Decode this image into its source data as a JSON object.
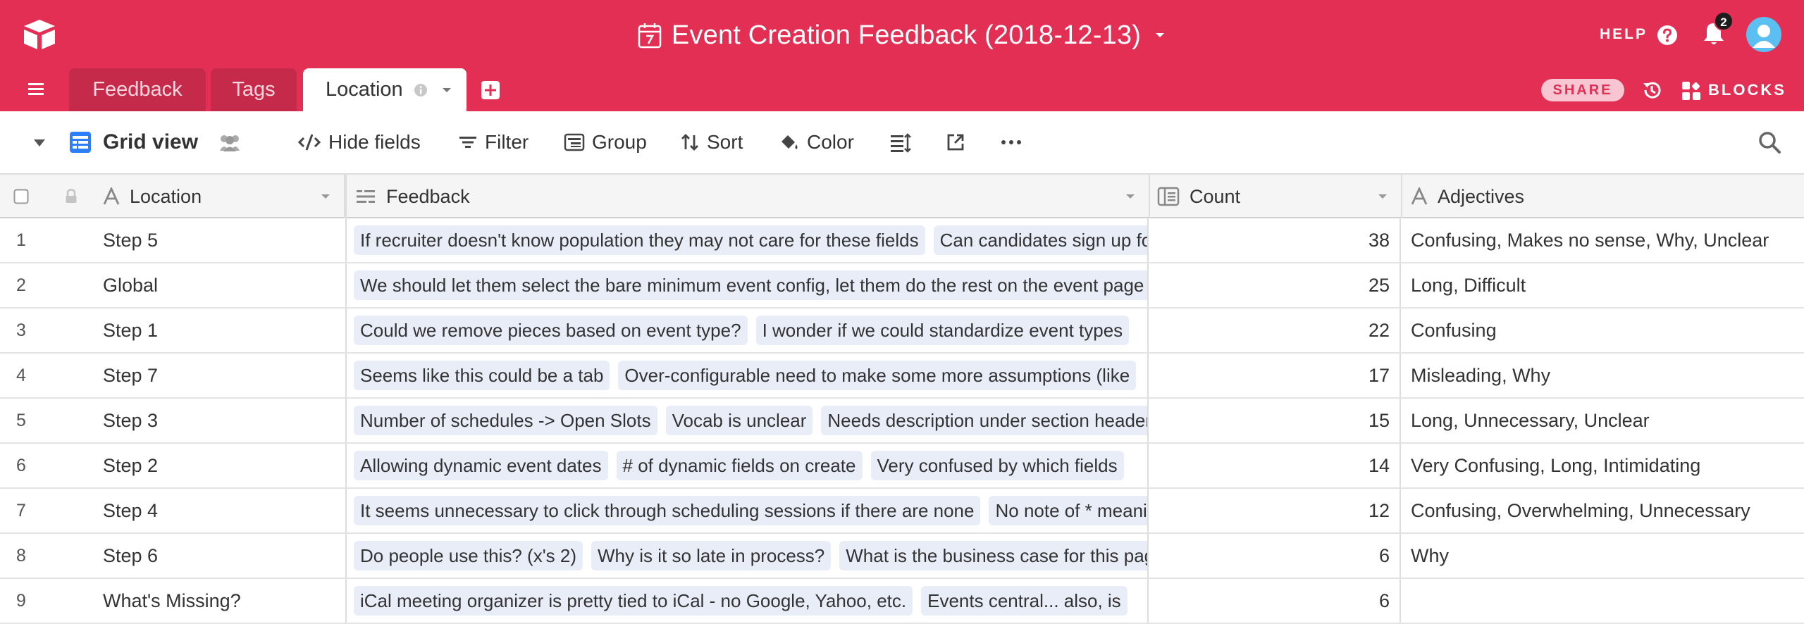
{
  "app": {
    "base_title": "Event Creation Feedback (2018-12-13)",
    "help_label": "HELP",
    "notification_count": "2",
    "share_label": "SHARE",
    "blocks_label": "BLOCKS"
  },
  "tabs": [
    {
      "label": "Feedback",
      "active": false
    },
    {
      "label": "Tags",
      "active": false
    },
    {
      "label": "Location",
      "active": true
    }
  ],
  "viewbar": {
    "view_name": "Grid view",
    "hide_fields": "Hide fields",
    "filter": "Filter",
    "group": "Group",
    "sort": "Sort",
    "color": "Color"
  },
  "columns": {
    "location": "Location",
    "feedback": "Feedback",
    "count": "Count",
    "adjectives": "Adjectives"
  },
  "rows": [
    {
      "num": "1",
      "location": "Step 5",
      "feedback": [
        "If recruiter doesn't know population they may not care for these fields",
        "Can candidates sign up for this"
      ],
      "count": "38",
      "adjectives": "Confusing, Makes no sense, Why, Unclear"
    },
    {
      "num": "2",
      "location": "Global",
      "feedback": [
        "We should let them select the bare minimum event config, let them do the rest on the event page"
      ],
      "count": "25",
      "adjectives": "Long, Difficult"
    },
    {
      "num": "3",
      "location": "Step 1",
      "feedback": [
        "Could we remove pieces based on event type?",
        "I wonder if we could standardize event types"
      ],
      "count": "22",
      "adjectives": "Confusing"
    },
    {
      "num": "4",
      "location": "Step 7",
      "feedback": [
        "Seems like this could be a tab",
        "Over-configurable need to make some more assumptions (like"
      ],
      "count": "17",
      "adjectives": "Misleading, Why"
    },
    {
      "num": "5",
      "location": "Step 3",
      "feedback": [
        "Number of schedules -> Open Slots",
        "Vocab is unclear",
        "Needs description under section headers"
      ],
      "count": "15",
      "adjectives": "Long, Unnecessary, Unclear"
    },
    {
      "num": "6",
      "location": "Step 2",
      "feedback": [
        "Allowing dynamic event dates",
        "# of dynamic fields on create",
        "Very confused by which fields"
      ],
      "count": "14",
      "adjectives": "Very Confusing, Long, Intimidating"
    },
    {
      "num": "7",
      "location": "Step 4",
      "feedback": [
        "It seems unnecessary to click through scheduling sessions if there are none",
        "No note of * meaning"
      ],
      "count": "12",
      "adjectives": "Confusing, Overwhelming, Unnecessary"
    },
    {
      "num": "8",
      "location": "Step 6",
      "feedback": [
        "Do people use this? (x's 2)",
        "Why is it so late in process?",
        "What is the business case for this page"
      ],
      "count": "6",
      "adjectives": "Why"
    },
    {
      "num": "9",
      "location": "What's Missing?",
      "feedback": [
        "iCal meeting organizer is pretty tied to iCal - no Google, Yahoo, etc.",
        "Events central... also, is"
      ],
      "count": "6",
      "adjectives": ""
    }
  ],
  "colors": {
    "brand": "#e42f55",
    "tab_inactive": "#c62a4b",
    "chip_bg": "#e9edf8",
    "grid_icon": "#2d7ff9"
  }
}
